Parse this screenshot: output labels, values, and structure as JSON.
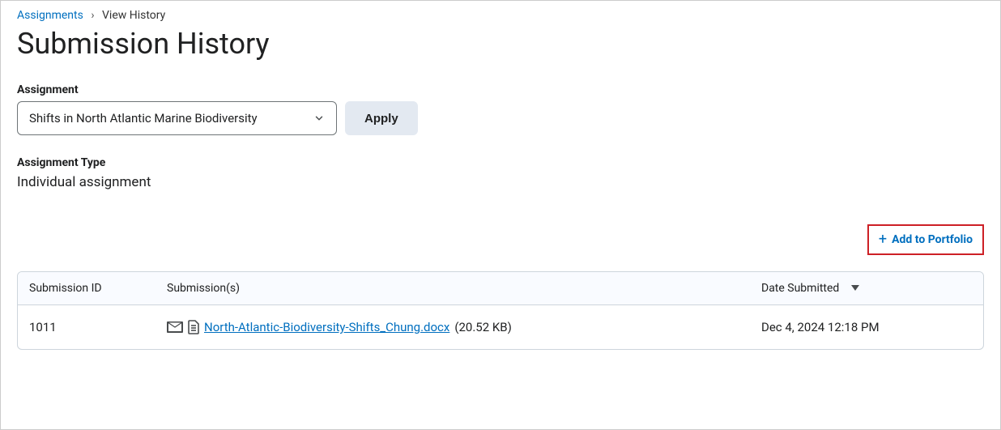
{
  "breadcrumb": {
    "root_label": "Assignments",
    "separator": "›",
    "current": "View History"
  },
  "title": "Submission History",
  "assignment_filter": {
    "label": "Assignment",
    "selected": "Shifts in North Atlantic Marine Biodiversity",
    "apply_label": "Apply"
  },
  "assignment_type": {
    "label": "Assignment Type",
    "value": "Individual assignment"
  },
  "actions": {
    "add_to_portfolio": "Add to Portfolio"
  },
  "table": {
    "headers": {
      "id": "Submission ID",
      "submissions": "Submission(s)",
      "date": "Date Submitted"
    },
    "rows": [
      {
        "id": "1011",
        "file_name": "North-Atlantic-Biodiversity-Shifts_Chung.docx",
        "file_size": "(20.52 KB)",
        "date": "Dec 4, 2024 12:18 PM"
      }
    ]
  }
}
